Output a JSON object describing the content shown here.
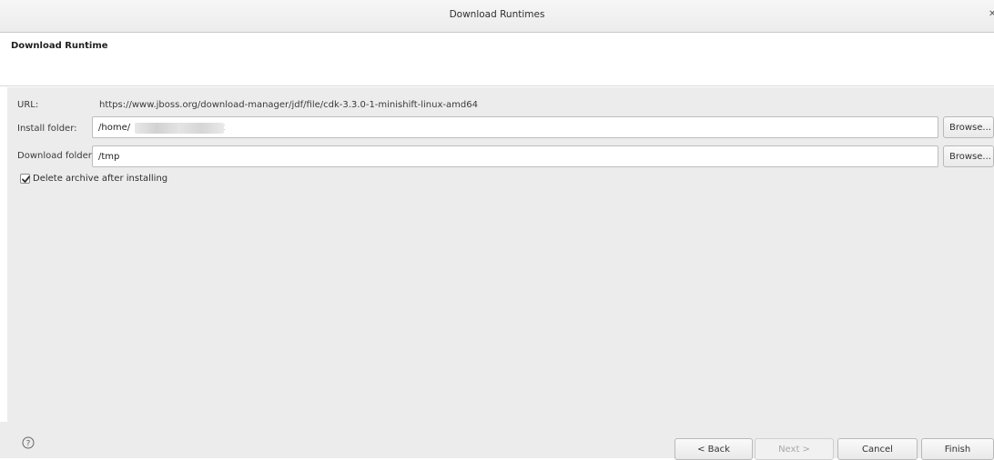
{
  "window": {
    "title": "Download Runtimes"
  },
  "banner": {
    "heading": "Download Runtime"
  },
  "form": {
    "url_label": "URL:",
    "url_value": "https://www.jboss.org/download-manager/jdf/file/cdk-3.3.0-1-minishift-linux-amd64",
    "install_label": "Install folder:",
    "install_value": "/home/                          /cdk",
    "download_label": "Download folder:",
    "download_value": "/tmp",
    "browse_label": "Browse...",
    "delete_archive_label": "Delete archive after installing",
    "delete_archive_checked": true
  },
  "footer": {
    "help_icon": "help-icon",
    "back_label": "< Back",
    "next_label": "Next >",
    "cancel_label": "Cancel",
    "finish_label": "Finish"
  },
  "colors": {
    "dialog_bg": "#ececec",
    "banner_bg": "#ffffff",
    "input_border": "#bdbdbd"
  }
}
